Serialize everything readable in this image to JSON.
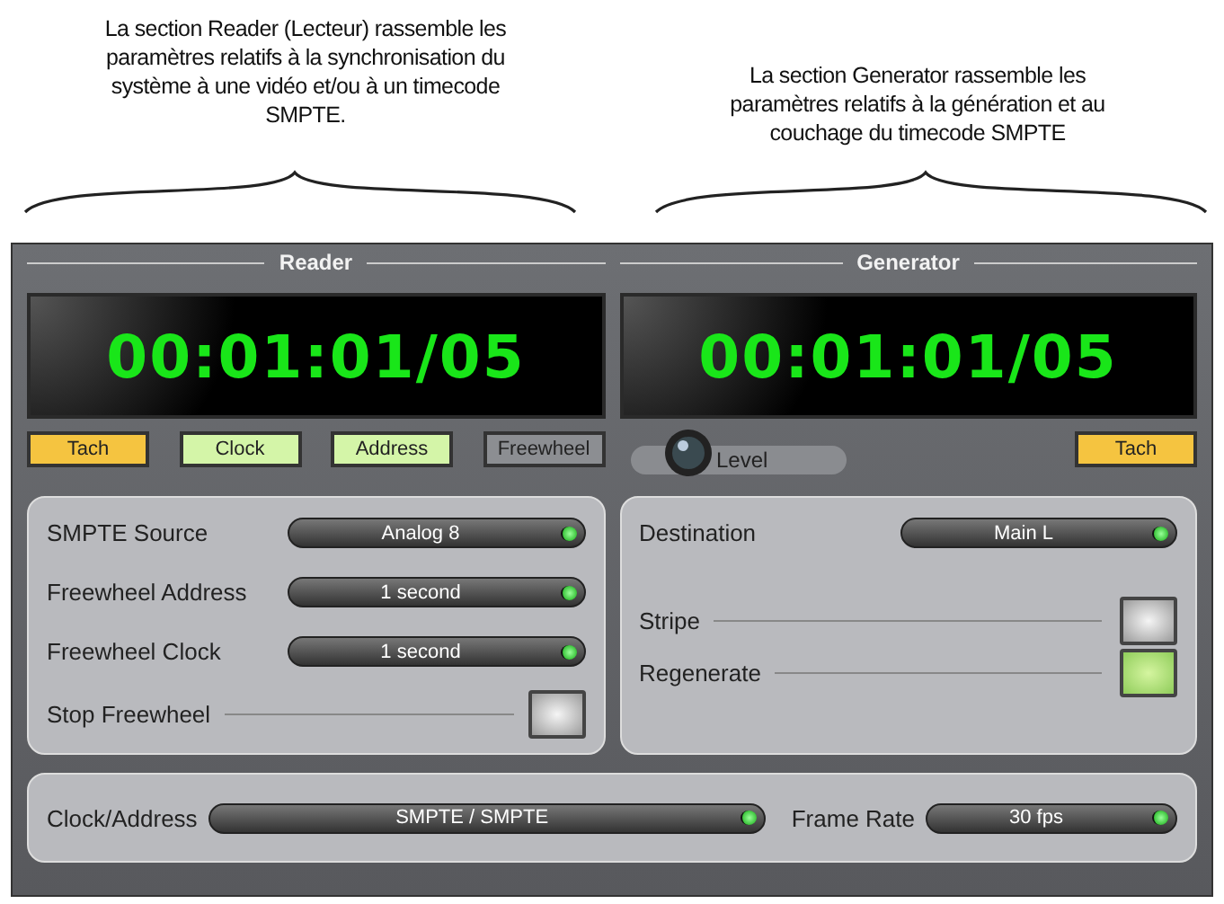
{
  "captions": [
    "La section Reader (Lecteur) rassemble les paramètres relatifs à la synchronisation du système à une vidéo et/ou à un timecode SMPTE.",
    "La section Generator rassemble les paramètres relatifs à la génération et au couchage du timecode SMPTE"
  ],
  "reader": {
    "title": "Reader",
    "timecode": "00:01:01/05",
    "indicators": [
      {
        "label": "Tach",
        "color": "#f5c440"
      },
      {
        "label": "Clock",
        "color": "#d4f5a8"
      },
      {
        "label": "Address",
        "color": "#d4f5a8"
      },
      {
        "label": "Freewheel",
        "color": "#8c8e92"
      }
    ],
    "settings": [
      {
        "kind": "dropdown",
        "label": "SMPTE Source",
        "value": "Analog 8"
      },
      {
        "kind": "dropdown",
        "label": "Freewheel Address",
        "value": "1 second"
      },
      {
        "kind": "dropdown",
        "label": "Freewheel Clock",
        "value": "1 second"
      },
      {
        "kind": "toggle",
        "label": "Stop Freewheel",
        "on": false
      }
    ]
  },
  "generator": {
    "title": "Generator",
    "timecode": "00:01:01/05",
    "knob_label": "Level",
    "indicators": [
      {
        "label": "Tach",
        "color": "#f5c440"
      }
    ],
    "settings": [
      {
        "kind": "dropdown",
        "label": "Destination",
        "value": "Main L"
      },
      {
        "kind": "toggle",
        "label": "Stripe",
        "on": false
      },
      {
        "kind": "toggle",
        "label": "Regenerate",
        "on": true
      }
    ]
  },
  "bottom": [
    {
      "label": "Clock/Address",
      "value": "SMPTE / SMPTE"
    },
    {
      "label": "Frame Rate",
      "value": "30 fps"
    }
  ]
}
